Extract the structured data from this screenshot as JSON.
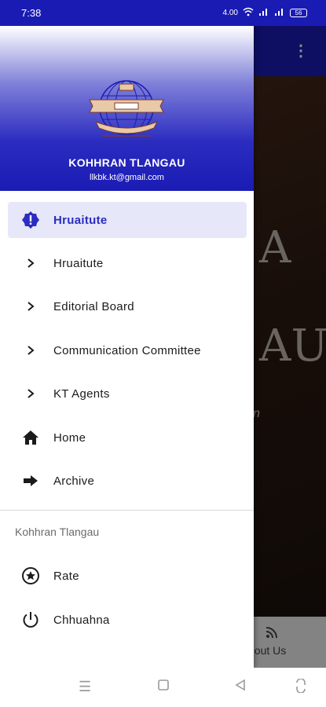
{
  "status": {
    "time": "7:38",
    "net_speed": "4.00",
    "battery": "56"
  },
  "background": {
    "big_text_1": "A",
    "big_text_2": "AU",
    "small_text": "n",
    "bottom_tab_label": "bout Us"
  },
  "drawer": {
    "title": "KOHHRAN TLANGAU",
    "email": "llkbk.kt@gmail.com",
    "items": [
      {
        "label": "Hruaitute",
        "icon": "alert-circle-icon",
        "active": true
      },
      {
        "label": "Hruaitute",
        "icon": "chevron-right-icon"
      },
      {
        "label": "Editorial Board",
        "icon": "chevron-right-icon"
      },
      {
        "label": "Communication Committee",
        "icon": "chevron-right-icon"
      },
      {
        "label": "KT Agents",
        "icon": "chevron-right-icon"
      },
      {
        "label": "Home",
        "icon": "home-icon"
      },
      {
        "label": "Archive",
        "icon": "arrow-right-icon"
      }
    ],
    "section_title": "Kohhran Tlangau",
    "section_items": [
      {
        "label": "Rate",
        "icon": "star-circle-icon"
      },
      {
        "label": "Chhuahna",
        "icon": "power-icon"
      }
    ]
  },
  "colors": {
    "primary": "#1a1bb3",
    "active_bg": "#e6e7f9",
    "active_text": "#2b2cc0"
  }
}
